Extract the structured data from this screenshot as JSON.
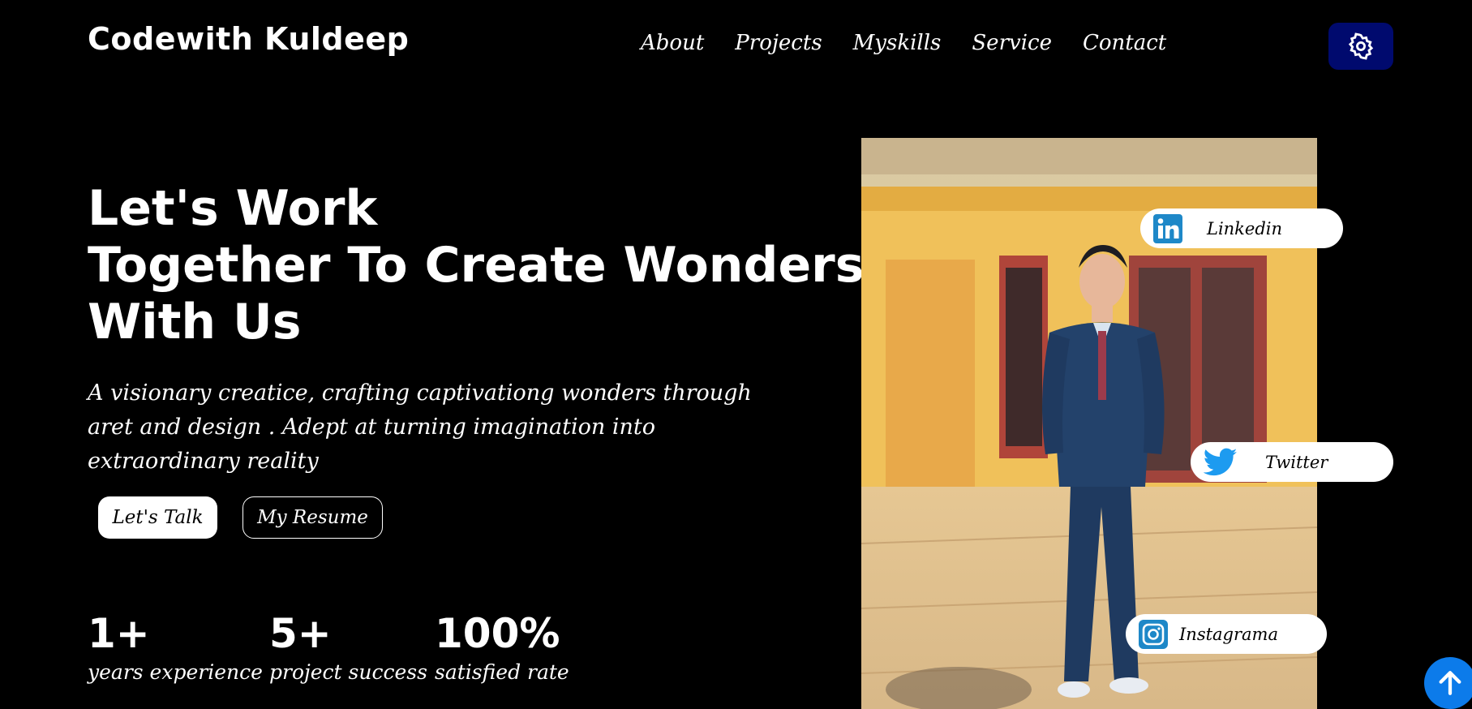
{
  "header": {
    "brand": "Codewith Kuldeep",
    "nav": [
      "About",
      "Projects",
      "Myskills",
      "Service",
      "Contact"
    ],
    "settings_icon": "gear-icon"
  },
  "hero": {
    "headline": [
      "Let's Work",
      "Together To Create Wonders",
      "With Us"
    ],
    "description": "A visionary creatice, crafting captivationg wonders through aret and design . Adept at turning imagination into extraordinary reality",
    "buttons": {
      "talk": "Let's Talk",
      "resume": "My Resume"
    },
    "stats": [
      {
        "value": "1+",
        "label": "years experience"
      },
      {
        "value": "5+",
        "label": "project success"
      },
      {
        "value": "100%",
        "label": "satisfied rate"
      }
    ]
  },
  "social": {
    "linkedin": "Linkedin",
    "twitter": "Twitter",
    "instagram": "Instagrama"
  },
  "colors": {
    "background": "#000000",
    "settings_button": "#000a6e",
    "scroll_top": "#0c7bea",
    "linkedin": "#1e88c8",
    "twitter": "#1d9bf0"
  },
  "icons": {
    "linkedin": "linkedin-icon",
    "twitter": "twitter-icon",
    "instagram": "instagram-icon",
    "scroll_top": "arrow-up-icon"
  }
}
